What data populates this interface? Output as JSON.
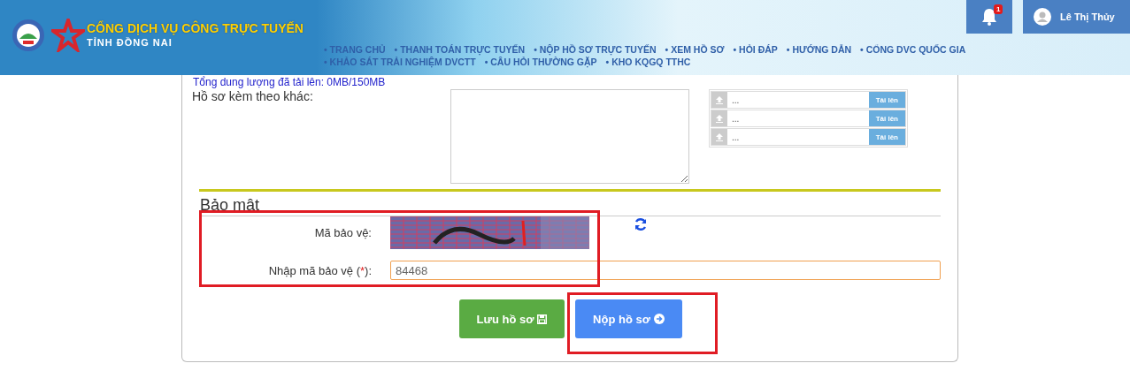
{
  "header": {
    "title": "CỔNG DỊCH VỤ CÔNG TRỰC TUYẾN",
    "subtitle": "TỈNH ĐỒNG NAI",
    "nav_rows": [
      {
        "items": [
          "• TRANG CHỦ",
          "• THANH TOÁN TRỰC TUYẾN",
          "• NỘP HỒ SƠ TRỰC TUYẾN",
          "• XEM HỒ SƠ",
          "• HỎI ĐÁP",
          "• HƯỚNG DẪN",
          "• CỔNG DVC QUỐC GIA"
        ]
      },
      {
        "items": [
          "• KHẢO SÁT TRẢI NGHIỆM DVCTT",
          "• CÂU HỎI THƯỜNG GẶP",
          "• KHO KQGQ TTHC"
        ]
      }
    ],
    "notification_count": "1",
    "user": "Lê Thị Thủy"
  },
  "storage_note": "Tổng dung lượng đã tải lên: 0MB/150MB",
  "attachments": {
    "label": "Hồ sơ kèm theo khác:",
    "files": [
      {
        "name": "...",
        "button": "Tải lên"
      },
      {
        "name": "...",
        "button": "Tải lên"
      },
      {
        "name": "...",
        "button": "Tải lên"
      }
    ]
  },
  "security": {
    "heading": "Bảo mật",
    "captcha_label": "Mã bảo vệ:",
    "input_label": "Nhập mã bảo vệ (",
    "required_mark": "*",
    "input_label_end": "):",
    "input_value": "84468"
  },
  "buttons": [
    {
      "label": "Lưu hồ sơ",
      "kind": "save"
    },
    {
      "label": "Nộp hồ sơ",
      "kind": "submit"
    }
  ]
}
